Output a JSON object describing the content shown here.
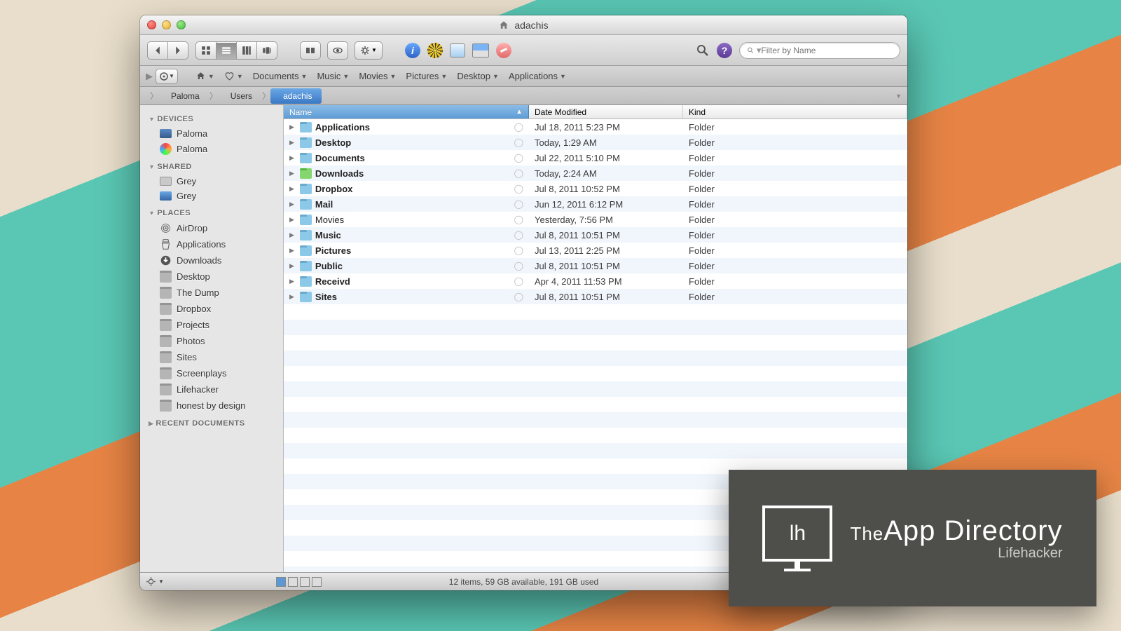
{
  "window": {
    "title": "adachis"
  },
  "toolbar": {
    "search_placeholder": "Filter by Name"
  },
  "favorites": [
    "Documents",
    "Music",
    "Movies",
    "Pictures",
    "Desktop",
    "Applications"
  ],
  "breadcrumb": {
    "root_icon": "apple",
    "items": [
      "Paloma",
      "Users",
      "adachis"
    ],
    "selected": "adachis"
  },
  "columns": {
    "name": "Name",
    "date": "Date Modified",
    "kind": "Kind"
  },
  "sidebar": {
    "devices_label": "DEVICES",
    "devices": [
      "Paloma",
      "Paloma"
    ],
    "shared_label": "SHARED",
    "shared": [
      "Grey",
      "Grey"
    ],
    "places_label": "PLACES",
    "places": [
      "AirDrop",
      "Applications",
      "Downloads",
      "Desktop",
      "The Dump",
      "Dropbox",
      "Projects",
      "Photos",
      "Sites",
      "Screenplays",
      "Lifehacker",
      "honest by design"
    ],
    "recent_label": "RECENT DOCUMENTS"
  },
  "rows": [
    {
      "name": "Applications",
      "date": "Jul 18, 2011 5:23 PM",
      "kind": "Folder",
      "bold": true
    },
    {
      "name": "Desktop",
      "date": "Today, 1:29 AM",
      "kind": "Folder",
      "bold": true
    },
    {
      "name": "Documents",
      "date": "Jul 22, 2011 5:10 PM",
      "kind": "Folder",
      "bold": true
    },
    {
      "name": "Downloads",
      "date": "Today, 2:24 AM",
      "kind": "Folder",
      "bold": true,
      "special": true
    },
    {
      "name": "Dropbox",
      "date": "Jul 8, 2011 10:52 PM",
      "kind": "Folder",
      "bold": true
    },
    {
      "name": "Mail",
      "date": "Jun 12, 2011 6:12 PM",
      "kind": "Folder",
      "bold": true
    },
    {
      "name": "Movies",
      "date": "Yesterday, 7:56 PM",
      "kind": "Folder",
      "bold": false
    },
    {
      "name": "Music",
      "date": "Jul 8, 2011 10:51 PM",
      "kind": "Folder",
      "bold": true
    },
    {
      "name": "Pictures",
      "date": "Jul 13, 2011 2:25 PM",
      "kind": "Folder",
      "bold": true
    },
    {
      "name": "Public",
      "date": "Jul 8, 2011 10:51 PM",
      "kind": "Folder",
      "bold": true
    },
    {
      "name": "Receivd",
      "date": "Apr 4, 2011 11:53 PM",
      "kind": "Folder",
      "bold": true
    },
    {
      "name": "Sites",
      "date": "Jul 8, 2011 10:51 PM",
      "kind": "Folder",
      "bold": true
    }
  ],
  "status": "12 items, 59 GB available, 191 GB used",
  "badge": {
    "logo_letters": "lh",
    "line1_small": "The",
    "line1_big": "App Directory",
    "line2": "Lifehacker"
  }
}
